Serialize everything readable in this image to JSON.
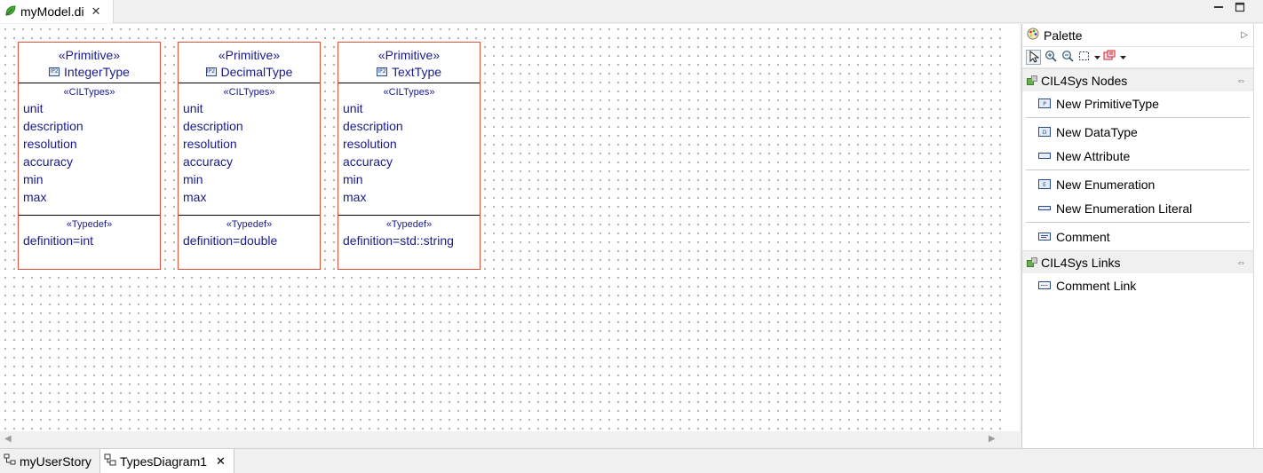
{
  "editor": {
    "tab_label": "myModel.di",
    "close_symbol": "✕",
    "minimize_symbol": "▬",
    "maximize_symbol": "□"
  },
  "classes": [
    {
      "stereotype": "«Primitive»",
      "name": "IntegerType",
      "icon_text": "IP2",
      "attr_stereotype": "«CILTypes»",
      "attributes": [
        "unit",
        "description",
        "resolution",
        "accuracy",
        "min",
        "max"
      ],
      "typedef_stereotype": "«Typedef»",
      "definition": "definition=int"
    },
    {
      "stereotype": "«Primitive»",
      "name": "DecimalType",
      "icon_text": "IP2",
      "attr_stereotype": "«CILTypes»",
      "attributes": [
        "unit",
        "description",
        "resolution",
        "accuracy",
        "min",
        "max"
      ],
      "typedef_stereotype": "«Typedef»",
      "definition": "definition=double"
    },
    {
      "stereotype": "«Primitive»",
      "name": "TextType",
      "icon_text": "IP2",
      "attr_stereotype": "«CILTypes»",
      "attributes": [
        "unit",
        "description",
        "resolution",
        "accuracy",
        "min",
        "max"
      ],
      "typedef_stereotype": "«Typedef»",
      "definition": "definition=std::string"
    }
  ],
  "palette": {
    "title": "Palette",
    "collapse_symbol": "▷",
    "tools": [
      "select-tool",
      "zoom-in-tool",
      "zoom-out-tool",
      "marquee-tool",
      "note-tool"
    ],
    "drawers": [
      {
        "title": "CIL4Sys Nodes",
        "pin_symbol": "⇔",
        "groups": [
          [
            "New PrimitiveType"
          ],
          [
            "New DataType",
            "New Attribute"
          ],
          [
            "New Enumeration",
            "New Enumeration Literal"
          ],
          [
            "Comment"
          ]
        ]
      },
      {
        "title": "CIL4Sys Links",
        "pin_symbol": "⇔",
        "groups": [
          [
            "Comment Link"
          ]
        ]
      }
    ]
  },
  "bottom_tabs": [
    {
      "label": "myUserStory",
      "active": false
    },
    {
      "label": "TypesDiagram1",
      "active": true,
      "close_symbol": "✕"
    }
  ],
  "colors": {
    "class_border": "#e0523a",
    "class_text": "#1a1a8c"
  }
}
